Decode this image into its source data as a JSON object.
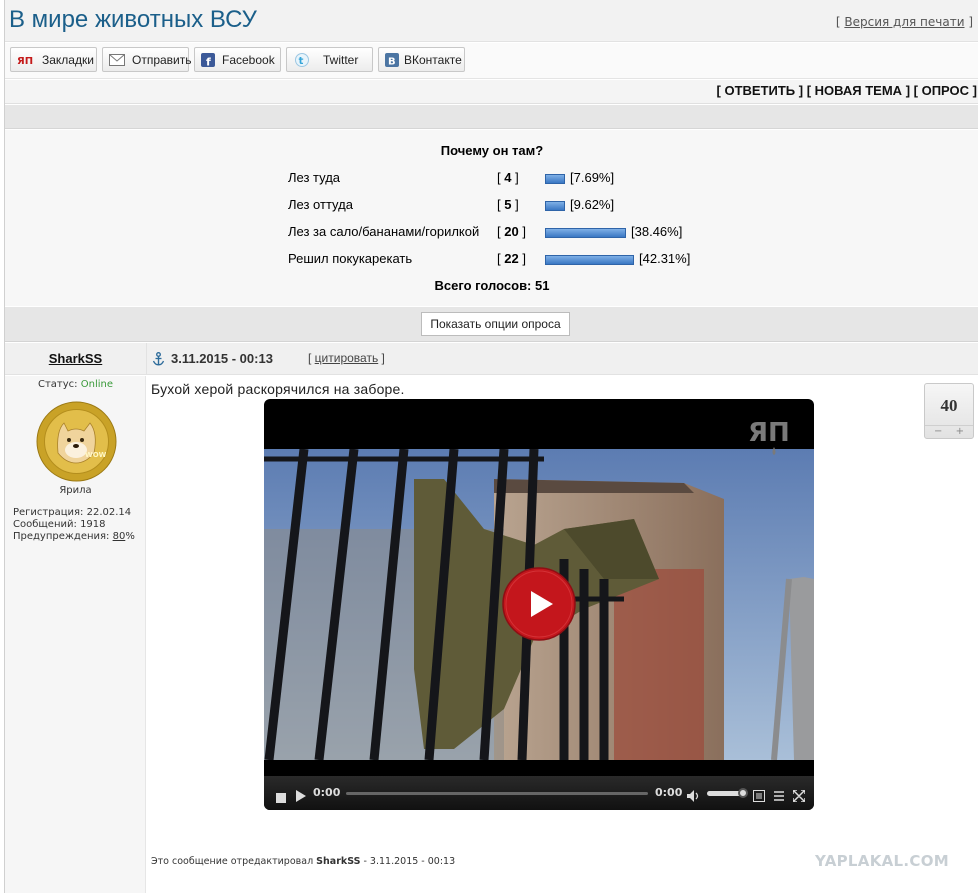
{
  "topic": {
    "title": "В мире животных ВСУ",
    "print_version": "Версия для печати"
  },
  "share": [
    {
      "label": "Закладки",
      "icon": "yap-icon"
    },
    {
      "label": "Отправить",
      "icon": "mail-icon"
    },
    {
      "label": "Facebook",
      "icon": "facebook-icon"
    },
    {
      "label": "Twitter",
      "icon": "twitter-icon"
    },
    {
      "label": "ВКонтакте",
      "icon": "vk-icon"
    }
  ],
  "actions": {
    "reply": "ОТВЕТИТЬ",
    "new_topic": "НОВАЯ ТЕМА",
    "poll": "ОПРОС"
  },
  "poll": {
    "question": "Почему он там?",
    "options": [
      {
        "label": "Лез туда",
        "votes": "4",
        "percent": "7.69%",
        "fraction": 0.0769
      },
      {
        "label": "Лез оттуда",
        "votes": "5",
        "percent": "9.62%",
        "fraction": 0.0962
      },
      {
        "label": "Лез за сало/бананами/горилкой",
        "votes": "20",
        "percent": "38.46%",
        "fraction": 0.3846
      },
      {
        "label": "Решил покукарекать",
        "votes": "22",
        "percent": "42.31%",
        "fraction": 0.4231
      }
    ],
    "total_label": "Всего голосов: 51",
    "show_options_label": "Показать опции опроса",
    "bar_color": "#4a86cf"
  },
  "post": {
    "author": "SharkSS",
    "date": "3.11.2015 - 00:13",
    "quote_label": "цитировать",
    "status_label": "Статус:",
    "status_value": "Online",
    "status_color": "#3a9a3a",
    "rank": "Ярила",
    "reg_label": "Регистрация:",
    "reg_value": "22.02.14",
    "msg_label": "Сообщений:",
    "msg_value": "1918",
    "warn_label": "Предупреждения:",
    "warn_value": "80",
    "warn_unit": "%",
    "text": "Бухой херой раскорячился на заборе.",
    "rating": "40",
    "rating_minus": "−",
    "rating_plus": "+",
    "edit_prefix": "Это сообщение отредактировал",
    "edit_author": "SharkSS",
    "edit_suffix": "- 3.11.2015 - 00:13",
    "watermark": "YAPLAKAL.COM"
  },
  "video": {
    "logo": "ЯП",
    "time_current": "0:00",
    "time_total": "0:00",
    "play_color": "#c4161c"
  }
}
